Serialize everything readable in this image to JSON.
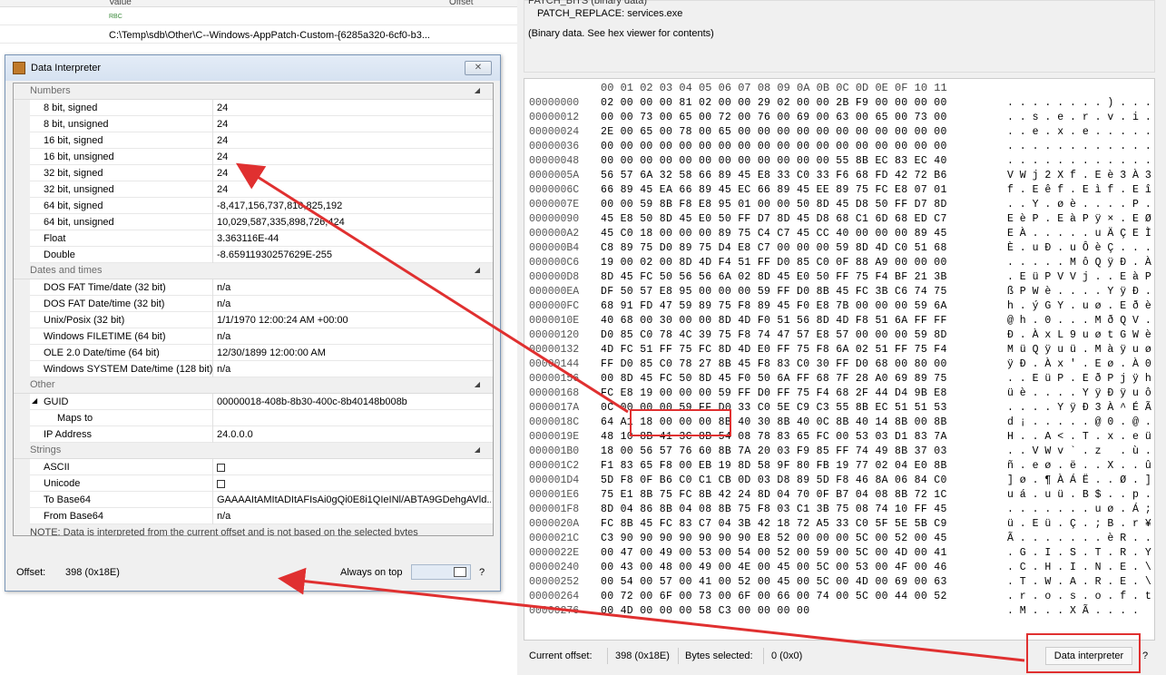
{
  "table": {
    "col_value": "Value",
    "col_offset": "Offset",
    "row1_value_icon": "RBC",
    "row2_value": "C:\\Temp\\sdb\\Other\\C--Windows-AppPatch-Custom-{6285a320-6cf0-b3..."
  },
  "props": {
    "line1": "PATCH_BITS (binary data)",
    "line2": "PATCH_REPLACE: services.exe",
    "line3": "(Binary data. See hex viewer for contents)"
  },
  "hex": {
    "header": "00 01 02 03 04 05 06 07 08 09 0A 0B 0C 0D 0E 0F 10 11",
    "rows": [
      {
        "off": "00000000",
        "bytes": "02 00 00 00 81 02 00 00 29 02 00 00 2B F9 00 00 00 00",
        "asc": ". . . . . . . . ) . . . + ù . . . ."
      },
      {
        "off": "00000012",
        "bytes": "00 00 73 00 65 00 72 00 76 00 69 00 63 00 65 00 73 00",
        "asc": ". . s . e . r . v . i . c . e . s ."
      },
      {
        "off": "00000024",
        "bytes": "2E 00 65 00 78 00 65 00 00 00 00 00 00 00 00 00 00 00",
        "asc": ". . e . x . e . . . . . . . . . . ."
      },
      {
        "off": "00000036",
        "bytes": "00 00 00 00 00 00 00 00 00 00 00 00 00 00 00 00 00 00",
        "asc": ". . . . . . . . . . . . . . . . . ."
      },
      {
        "off": "00000048",
        "bytes": "00 00 00 00 00 00 00 00 00 00 00 00 55 8B EC 83 EC 40",
        "asc": ". . . . . . . . . . . . U . ì . ì @"
      },
      {
        "off": "0000005A",
        "bytes": "56 57 6A 32 58 66 89 45 E8 33 C0 33 F6 68 FD 42 72 B6",
        "asc": "V W j 2 X f . E è 3 À 3 ö h ý B r ¶"
      },
      {
        "off": "0000006C",
        "bytes": "66 89 45 EA 66 89 45 EC 66 89 45 EE 89 75 FC E8 07 01",
        "asc": "f . E ê f . E ì f . E î . u ü è . ."
      },
      {
        "off": "0000007E",
        "bytes": "00 00 59 8B F8 E8 95 01 00 00 50 8D 45 D8 50 FF D7 8D",
        "asc": ". . Y . ø è . . . . P . E Ø P ÿ × ."
      },
      {
        "off": "00000090",
        "bytes": "45 E8 50 8D 45 E0 50 FF D7 8D 45 D8 68 C1 6D 68 ED C7",
        "asc": "E è P . E à P ÿ × . E Ø h Á m h í Ç"
      },
      {
        "off": "000000A2",
        "bytes": "45 C0 18 00 00 00 89 75 C4 C7 45 CC 40 00 00 00 89 45",
        "asc": "E À . . . . . u Ä Ç E Ì @ . . . . E"
      },
      {
        "off": "000000B4",
        "bytes": "C8 89 75 D0 89 75 D4 E8 C7 00 00 00 59 8D 4D C0 51 68",
        "asc": "È . u Ð . u Ô è Ç . . . Y . M À Q h"
      },
      {
        "off": "000000C6",
        "bytes": "19 00 02 00 8D 4D F4 51 FF D0 85 C0 0F 88 A9 00 00 00",
        "asc": ". . . . . M ô Q ÿ Ð . À . . © . . ."
      },
      {
        "off": "000000D8",
        "bytes": "8D 45 FC 50 56 56 6A 02 8D 45 E0 50 FF 75 F4 BF 21 3B",
        "asc": ". E ü P V V j . . E à P ÿ u ô ¿ ! ;"
      },
      {
        "off": "000000EA",
        "bytes": "DF 50 57 E8 95 00 00 00 59 FF D0 8B 45 FC 3B C6 74 75",
        "asc": "ß P W è . . . . Y ÿ Ð . E ü ; Æ t u"
      },
      {
        "off": "000000FC",
        "bytes": "68 91 FD 47 59 89 75 F8 89 45 F0 E8 7B 00 00 00 59 6A",
        "asc": "h . ý G Y . u ø . E ð è { . . . Y j"
      },
      {
        "off": "0000010E",
        "bytes": "40 68 00 30 00 00 8D 4D F0 51 56 8D 4D F8 51 6A FF FF",
        "asc": "@ h . 0 . . . M ð Q V . M ø Q j ÿ ÿ"
      },
      {
        "off": "00000120",
        "bytes": "D0 85 C0 78 4C 39 75 F8 74 47 57 E8 57 00 00 00 59 8D",
        "asc": "Ð . À x L 9 u ø t G W è W . . . Y ."
      },
      {
        "off": "00000132",
        "bytes": "4D FC 51 FF 75 FC 8D 4D E0 FF 75 F8 6A 02 51 FF 75 F4",
        "asc": "M ü Q ÿ u ü . M à ÿ u ø j . Q ÿ u ô"
      },
      {
        "off": "00000144",
        "bytes": "FF D0 85 C0 78 27 8B 45 F8 83 C0 30 FF D0 68 00 80 00",
        "asc": "ÿ Ð . À x ' . E ø . À 0 ÿ Ð h . . ."
      },
      {
        "off": "00000156",
        "bytes": "00 8D 45 FC 50 8D 45 F0 50 6A FF 68 7F 28 A0 69 89 75",
        "asc": ". . E ü P . E ð P j ÿ h . (   i . u"
      },
      {
        "off": "00000168",
        "bytes": "FC E8 19 00 00 00 59 FF D0 FF 75 F4 68 2F 44 D4 9B E8",
        "asc": "ü è . . . . Y ÿ Ð ÿ u ô h / D Ô . è"
      },
      {
        "off": "0000017A",
        "bytes": "0C 00 00 00 59 FF D0 33 C0 5E C9 C3 55 8B EC 51 51 53",
        "asc": ". . . . Y ÿ Ð 3 À ^ É Ã U . ì Q Q S"
      },
      {
        "off": "0000018C",
        "bytes": "64 A1 18 00 00 00 8B 40 30 8B 40 0C 8B 40 14 8B 00 8B",
        "asc": "d ¡ . . . . . @ 0 . @ . . @ . . . ."
      },
      {
        "off": "0000019E",
        "bytes": "48 10 8B 41 3C 8B 54 08 78 83 65 FC 00 53 03 D1 83 7A",
        "asc": "H . . A < . T . x . e ü . S . Ñ . z"
      },
      {
        "off": "000001B0",
        "bytes": "18 00 56 57 76 60 8B 7A 20 03 F9 85 FF 74 49 8B 37 03",
        "asc": ". . V W v ` . z   . ù . ÿ t I . 7 ."
      },
      {
        "off": "000001C2",
        "bytes": "F1 83 65 F8 00 EB 19 8D 58 9F 80 FB 19 77 02 04 E0 8B",
        "asc": "ñ . e ø . ë . . X . . û . w . . à ."
      },
      {
        "off": "000001D4",
        "bytes": "5D F8 0F B6 C0 C1 CB 0D 03 D8 89 5D F8 46 8A 06 84 C0",
        "asc": "] ø . ¶ À Á Ë . . Ø . ] ø F . . . À"
      },
      {
        "off": "000001E6",
        "bytes": "75 E1 8B 75 FC 8B 42 24 8D 04 70 0F B7 04 08 8B 72 1C",
        "asc": "u á . u ü . B $ . . p . · . . . r ."
      },
      {
        "off": "000001F8",
        "bytes": "8D 04 86 8B 04 08 8B 75 F8 03 C1 3B 75 08 74 10 FF 45",
        "asc": ". . . . . . . u ø . Á ; u . t . ÿ E"
      },
      {
        "off": "0000020A",
        "bytes": "FC 8B 45 FC 83 C7 04 3B 42 18 72 A5 33 C0 5F 5E 5B C9",
        "asc": "ü . E ü . Ç . ; B . r ¥ 3 À _ ^ [ É"
      },
      {
        "off": "0000021C",
        "bytes": "C3 90 90 90 90 90 90 90 E8 52 00 00 00 5C 00 52 00 45",
        "asc": "Ã . . . . . . . è R . . . \\ . R . E"
      },
      {
        "off": "0000022E",
        "bytes": "00 47 00 49 00 53 00 54 00 52 00 59 00 5C 00 4D 00 41",
        "asc": ". G . I . S . T . R . Y . \\ . M . A"
      },
      {
        "off": "00000240",
        "bytes": "00 43 00 48 00 49 00 4E 00 45 00 5C 00 53 00 4F 00 46",
        "asc": ". C . H . I . N . E . \\ . S . O . F"
      },
      {
        "off": "00000252",
        "bytes": "00 54 00 57 00 41 00 52 00 45 00 5C 00 4D 00 69 00 63",
        "asc": ". T . W . A . R . E . \\ . M . i . c"
      },
      {
        "off": "00000264",
        "bytes": "00 72 00 6F 00 73 00 6F 00 66 00 74 00 5C 00 44 00 52",
        "asc": ". r . o . s . o . f . t . \\ . D . R"
      },
      {
        "off": "00000276",
        "bytes": "00 4D 00 00 00 58 C3 00 00 00 00",
        "asc": ". M . . . X Ã . . . ."
      }
    ]
  },
  "status": {
    "current_offset_label": "Current offset:",
    "current_offset": "398 (0x18E)",
    "bytes_selected_label": "Bytes selected:",
    "bytes_selected": "0 (0x0)",
    "data_interpreter": "Data interpreter",
    "help": "?"
  },
  "dialog": {
    "title": "Data Interpreter",
    "close_glyph": "✕",
    "categories": {
      "numbers": "Numbers",
      "dates": "Dates and times",
      "other": "Other",
      "strings": "Strings"
    },
    "numbers": [
      {
        "name": "8 bit, signed",
        "value": "24"
      },
      {
        "name": "8 bit, unsigned",
        "value": "24"
      },
      {
        "name": "16 bit, signed",
        "value": "24"
      },
      {
        "name": "16 bit, unsigned",
        "value": "24"
      },
      {
        "name": "32 bit, signed",
        "value": "24"
      },
      {
        "name": "32 bit, unsigned",
        "value": "24"
      },
      {
        "name": "64 bit, signed",
        "value": "-8,417,156,737,810,825,192"
      },
      {
        "name": "64 bit, unsigned",
        "value": "10,029,587,335,898,726,424"
      },
      {
        "name": "Float",
        "value": "3.363116E-44"
      },
      {
        "name": "Double",
        "value": "-8.65911930257629E-255"
      }
    ],
    "dates": [
      {
        "name": "DOS FAT Time/date (32 bit)",
        "value": "n/a"
      },
      {
        "name": "DOS FAT Date/time (32 bit)",
        "value": "n/a"
      },
      {
        "name": "Unix/Posix (32 bit)",
        "value": "1/1/1970 12:00:24 AM +00:00"
      },
      {
        "name": "Windows FILETIME (64 bit)",
        "value": "n/a"
      },
      {
        "name": "OLE 2.0 Date/time (64 bit)",
        "value": "12/30/1899 12:00:00 AM"
      },
      {
        "name": "Windows SYSTEM Date/time (128 bit)",
        "value": "n/a"
      }
    ],
    "other": [
      {
        "name": "GUID",
        "value": "00000018-408b-8b30-400c-8b40148b008b"
      },
      {
        "name": "Maps to",
        "value": ""
      },
      {
        "name": "IP Address",
        "value": "24.0.0.0"
      }
    ],
    "strings": [
      {
        "name": "ASCII",
        "value": ""
      },
      {
        "name": "Unicode",
        "value": ""
      },
      {
        "name": "To Base64",
        "value": "GAAAAItAMItADItAFIsAi0gQi0E8i1QIeINl/ABTA9GDehgAVld..."
      },
      {
        "name": "From Base64",
        "value": "n/a"
      }
    ],
    "note": "NOTE: Data is interpreted from the current offset and is not based on the selected bytes",
    "offset_label": "Offset:",
    "offset_value": "398 (0x18E)",
    "always_on_top": "Always on top",
    "help": "?"
  },
  "colors": {
    "annotation": "#e03030"
  }
}
